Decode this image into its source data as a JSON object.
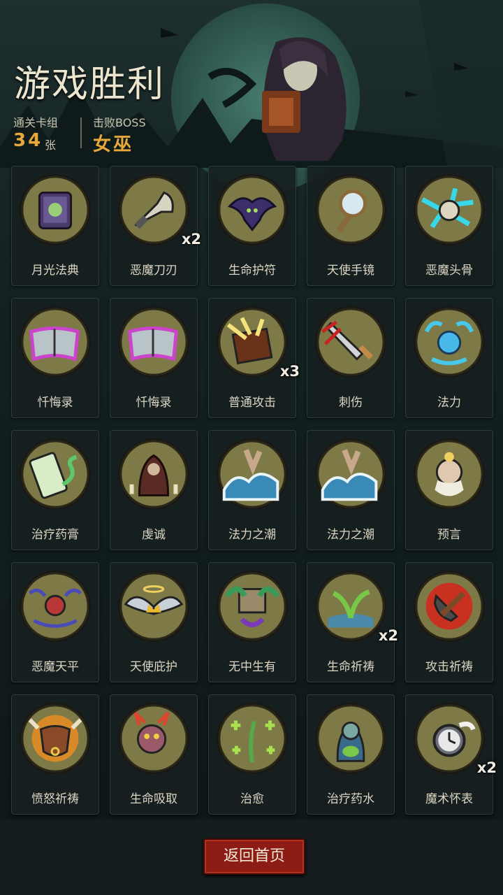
{
  "header": {
    "title": "游戏胜利",
    "deck_label": "通关卡组",
    "deck_count": "34",
    "deck_unit": "张",
    "boss_label": "击败BOSS",
    "boss_name": "女巫"
  },
  "colors": {
    "accent": "#e9a93a",
    "card_circle": "#7d7a47",
    "button": "#8d1c14"
  },
  "cards": [
    {
      "name": "月光法典",
      "icon": "spellbook-icon",
      "count": ""
    },
    {
      "name": "恶魔刀刃",
      "icon": "demon-blade-icon",
      "count": "x2"
    },
    {
      "name": "生命护符",
      "icon": "bat-amulet-icon",
      "count": ""
    },
    {
      "name": "天使手镜",
      "icon": "hand-mirror-icon",
      "count": ""
    },
    {
      "name": "恶魔头骨",
      "icon": "skull-lightning-icon",
      "count": ""
    },
    {
      "name": "忏悔录",
      "icon": "glowing-book-icon",
      "count": ""
    },
    {
      "name": "忏悔录",
      "icon": "glowing-book-icon",
      "count": ""
    },
    {
      "name": "普通攻击",
      "icon": "attack-book-icon",
      "count": "x3"
    },
    {
      "name": "刺伤",
      "icon": "dagger-icon",
      "count": ""
    },
    {
      "name": "法力",
      "icon": "mana-orb-icon",
      "count": ""
    },
    {
      "name": "治疗药膏",
      "icon": "ointment-tube-icon",
      "count": ""
    },
    {
      "name": "虔诚",
      "icon": "praying-monk-icon",
      "count": ""
    },
    {
      "name": "法力之潮",
      "icon": "wave-hand-icon",
      "count": ""
    },
    {
      "name": "法力之潮",
      "icon": "wave-hand-icon",
      "count": ""
    },
    {
      "name": "预言",
      "icon": "prophet-icon",
      "count": ""
    },
    {
      "name": "恶魔天平",
      "icon": "demon-scale-icon",
      "count": ""
    },
    {
      "name": "天使庇护",
      "icon": "angel-wings-icon",
      "count": ""
    },
    {
      "name": "无中生有",
      "icon": "sprout-box-icon",
      "count": ""
    },
    {
      "name": "生命祈祷",
      "icon": "sprout-icon",
      "count": "x2"
    },
    {
      "name": "攻击祈祷",
      "icon": "axe-fire-icon",
      "count": ""
    },
    {
      "name": "愤怒祈祷",
      "icon": "bull-head-icon",
      "count": ""
    },
    {
      "name": "生命吸取",
      "icon": "demon-imp-icon",
      "count": ""
    },
    {
      "name": "治愈",
      "icon": "healing-plant-icon",
      "count": ""
    },
    {
      "name": "治疗药水",
      "icon": "zombie-potion-icon",
      "count": ""
    },
    {
      "name": "魔术怀表",
      "icon": "pocket-watch-icon",
      "count": "x2"
    }
  ],
  "footer": {
    "return_button": "返回首页"
  }
}
